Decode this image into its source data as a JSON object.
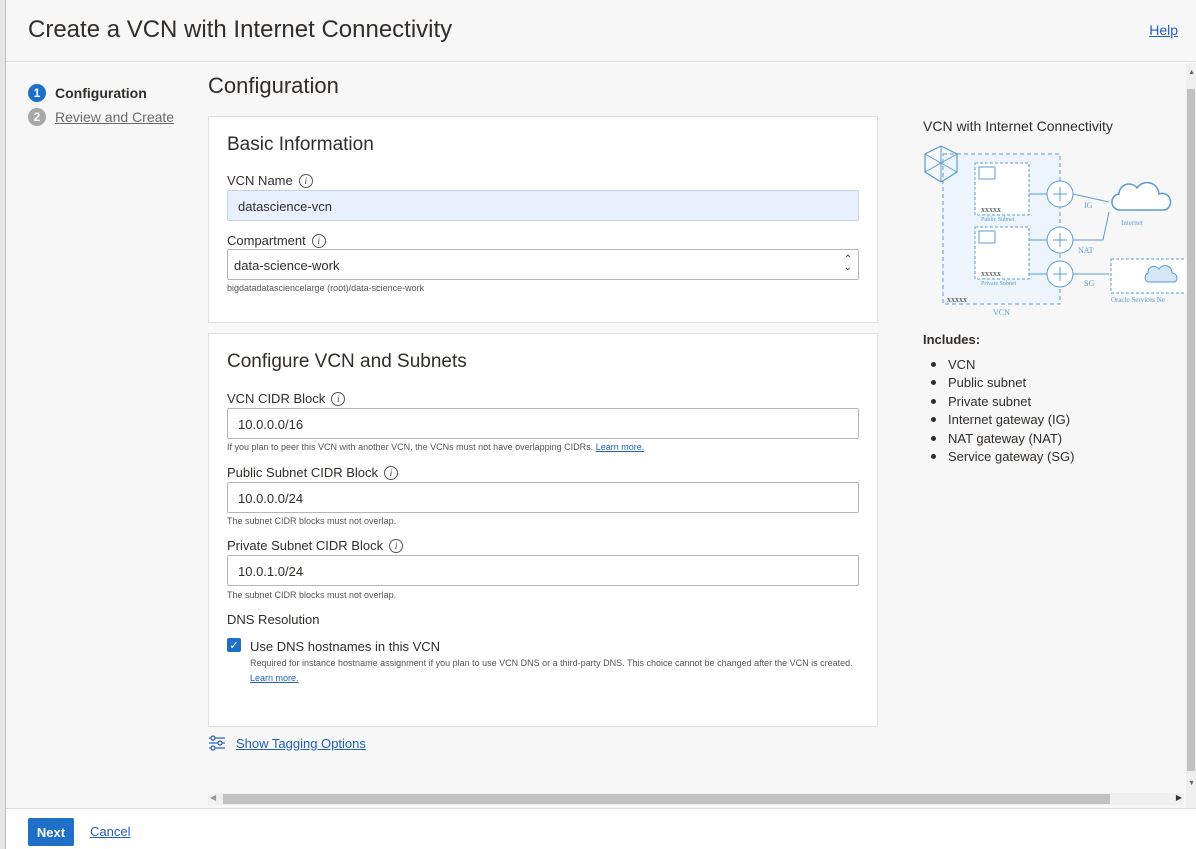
{
  "header": {
    "title": "Create a VCN with Internet Connectivity",
    "help": "Help"
  },
  "steps": [
    {
      "num": "1",
      "label": "Configuration"
    },
    {
      "num": "2",
      "label": "Review and Create"
    }
  ],
  "main": {
    "title": "Configuration",
    "basic": {
      "title": "Basic Information",
      "vcn_name_label": "VCN Name",
      "vcn_name_value": "datascience-vcn",
      "compartment_label": "Compartment",
      "compartment_value": "data-science-work",
      "compartment_path": "bigdatadatasciencelarge (root)/data-science-work"
    },
    "configure": {
      "title": "Configure VCN and Subnets",
      "vcn_cidr_label": "VCN CIDR Block",
      "vcn_cidr_value": "10.0.0.0/16",
      "vcn_cidr_help": "If you plan to peer this VCN with another VCN, the VCNs must not have overlapping CIDRs.",
      "learn_more": "Learn more.",
      "public_cidr_label": "Public Subnet CIDR Block",
      "public_cidr_value": "10.0.0.0/24",
      "public_cidr_help": "The subnet CIDR blocks must not overlap.",
      "private_cidr_label": "Private Subnet CIDR Block",
      "private_cidr_value": "10.0.1.0/24",
      "private_cidr_help": "The subnet CIDR blocks must not overlap.",
      "dns_title": "DNS Resolution",
      "dns_checkbox_label": "Use DNS hostnames in this VCN",
      "dns_checked": true,
      "dns_desc": "Required for instance hostname assignment if you plan to use VCN DNS or a third-party DNS. This choice cannot be changed after the VCN is created."
    },
    "tagging": "Show Tagging Options"
  },
  "side": {
    "title": "VCN with Internet Connectivity",
    "diagram": {
      "public_subnet": "Public Subnet",
      "private_subnet": "Private Subnet",
      "xxxxx": "xxxxx",
      "ig": "IG",
      "nat": "NAT",
      "sg": "SG",
      "internet": "Internet",
      "oracle": "Oracle Services Ne",
      "vcn": "VCN"
    },
    "includes_title": "Includes:",
    "includes": [
      "VCN",
      "Public subnet",
      "Private subnet",
      "Internet gateway (IG)",
      "NAT gateway (NAT)",
      "Service gateway (SG)"
    ]
  },
  "footer": {
    "next": "Next",
    "cancel": "Cancel"
  },
  "colors": {
    "accent": "#1f6fc9",
    "link": "#1f5fbf",
    "diagram": "#5b9bd5"
  }
}
